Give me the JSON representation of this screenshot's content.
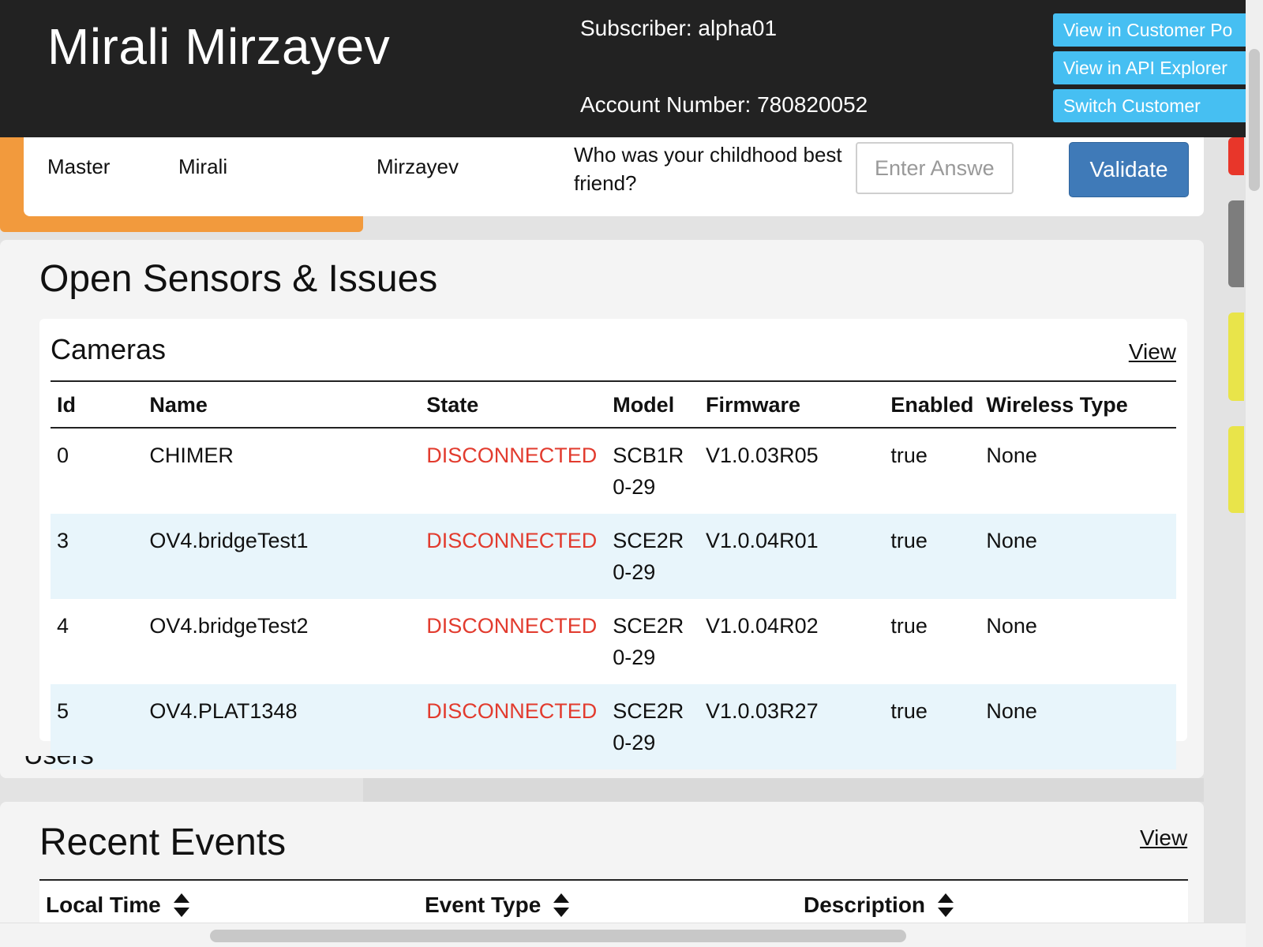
{
  "header": {
    "customer_name": "Mirali Mirzayev",
    "subscriber": "Subscriber: alpha01",
    "account_number": "Account Number: 780820052",
    "buttons": [
      "View in Customer Po",
      "View in API Explorer",
      "Switch Customer"
    ],
    "button_color": "#46bff2"
  },
  "verify": {
    "role": "Master",
    "first_name": "Mirali",
    "last_name": "Mirzayev",
    "question": "Who was your childhood best friend?",
    "answer_placeholder": "Enter Answer",
    "validate_label": "Validate"
  },
  "sensors": {
    "title": "Open Sensors & Issues",
    "cameras": {
      "title": "Cameras",
      "view_label": "View",
      "columns": [
        "Id",
        "Name",
        "State",
        "Model",
        "Firmware",
        "Enabled",
        "Wireless Type"
      ],
      "rows": [
        {
          "id": "0",
          "name": "CHIMER",
          "state": "DISCONNECTED",
          "model": "SCB1R0-29",
          "firmware": "V1.0.03R05",
          "enabled": "true",
          "wireless": "None"
        },
        {
          "id": "3",
          "name": "OV4.bridgeTest1",
          "state": "DISCONNECTED",
          "model": "SCE2R0-29",
          "firmware": "V1.0.04R01",
          "enabled": "true",
          "wireless": "None"
        },
        {
          "id": "4",
          "name": "OV4.bridgeTest2",
          "state": "DISCONNECTED",
          "model": "SCE2R0-29",
          "firmware": "V1.0.04R02",
          "enabled": "true",
          "wireless": "None"
        },
        {
          "id": "5",
          "name": "OV4.PLAT1348",
          "state": "DISCONNECTED",
          "model": "SCE2R0-29",
          "firmware": "V1.0.03R27",
          "enabled": "true",
          "wireless": "None"
        }
      ]
    }
  },
  "users_label": "Users",
  "events": {
    "title": "Recent Events",
    "view_label": "View",
    "columns": [
      "Local Time",
      "Event Type",
      "Description"
    ]
  },
  "colors": {
    "header_bg": "#222222",
    "accent_orange": "#f29a3d",
    "validate_blue": "#3f7ab8",
    "disconnected_red": "#e23b2e",
    "flag_red": "#e8362a",
    "flag_gray": "#7d7d7d",
    "flag_yellow": "#e9e44a"
  }
}
